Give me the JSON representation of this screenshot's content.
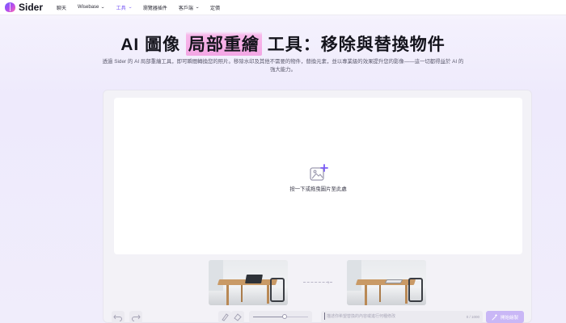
{
  "nav": {
    "brand": "Sider",
    "items": [
      {
        "label": "聊天",
        "dropdown": false,
        "active": false
      },
      {
        "label": "Wisebase",
        "dropdown": true,
        "active": false
      },
      {
        "label": "工具",
        "dropdown": true,
        "active": true
      },
      {
        "label": "瀏覽器插件",
        "dropdown": false,
        "active": false
      },
      {
        "label": "客戶端",
        "dropdown": true,
        "active": false
      },
      {
        "label": "定價",
        "dropdown": false,
        "active": false
      }
    ]
  },
  "hero": {
    "title_prefix": "AI 圖像",
    "title_highlight": "局部重繪",
    "title_suffix": "工具：移除與替換物件",
    "description": "透過 Sider 的 AI 局部重繪工具，即可瞬間轉換您的照片。移除水印及其他不需要的物件，替換元素，並以專業級的效果提升您的影像——這一切都得益於 AI 的強大能力。"
  },
  "editor": {
    "upload_hint": "按一下或拖曳圖片至此處",
    "prompt_placeholder": "描述你希望替換的內容或進行何種修改",
    "char_count": "0 / 1000",
    "generate_label": "開始繪製",
    "brush_size": 0.58
  },
  "colors": {
    "accent": "#7b5cf5",
    "highlight": "#f3a6e4",
    "generate_button": "#c9b7f6"
  }
}
